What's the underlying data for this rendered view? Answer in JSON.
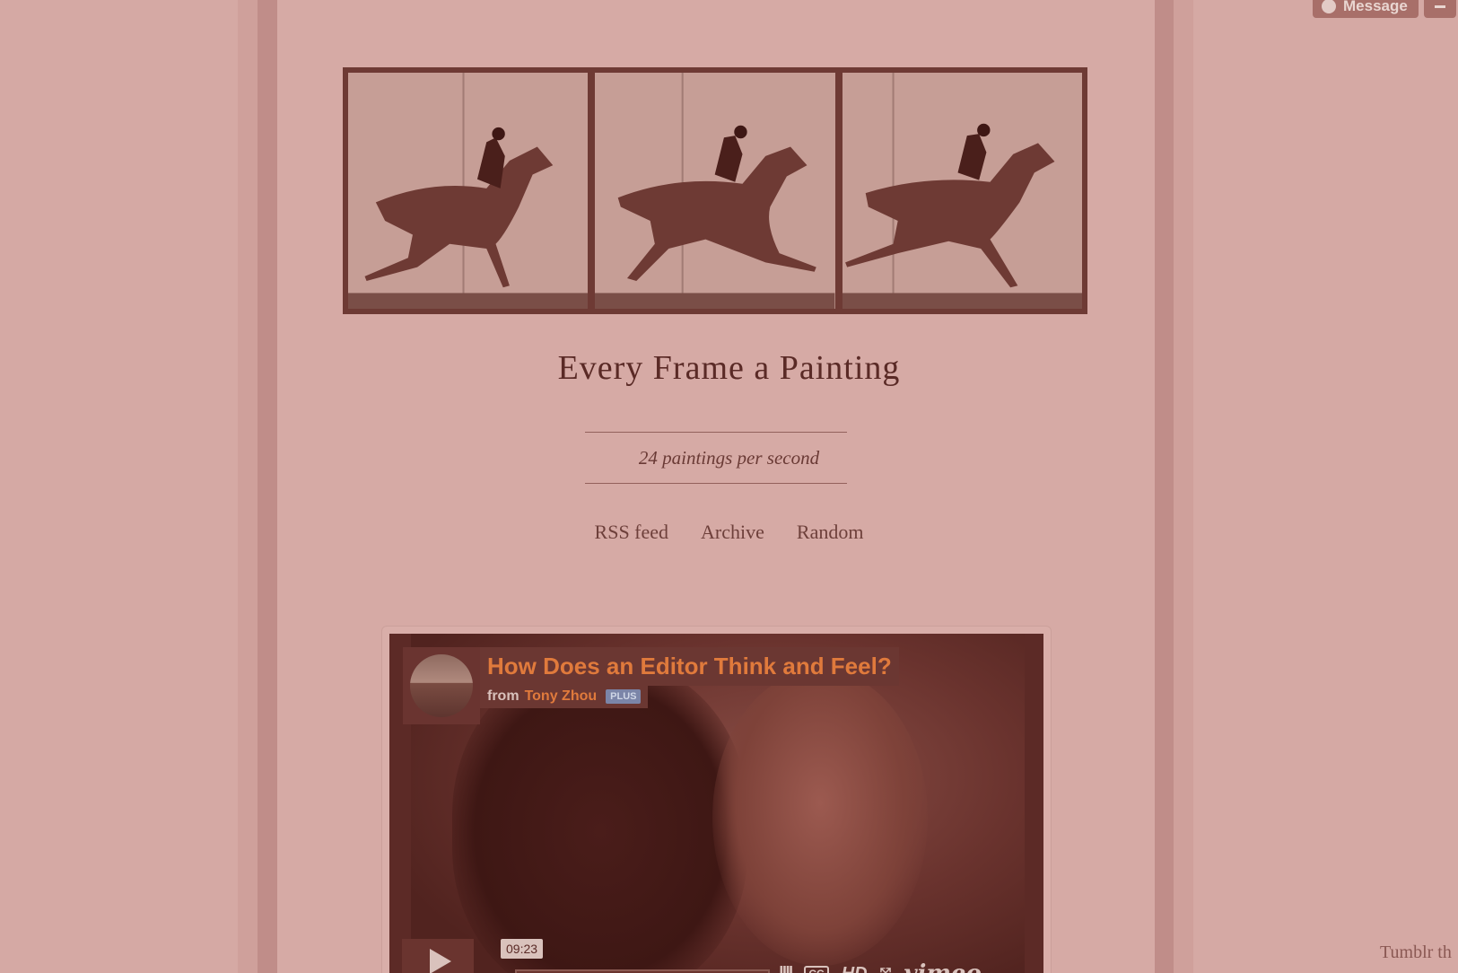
{
  "blog": {
    "title": "Every Frame a Painting",
    "tagline": "24 paintings per second"
  },
  "nav": {
    "items": [
      {
        "label": "RSS feed"
      },
      {
        "label": "Archive"
      },
      {
        "label": "Random"
      }
    ]
  },
  "video": {
    "title": "How Does an Editor Think and Feel?",
    "from_label": "from",
    "author": "Tony Zhou",
    "badge": "PLUS",
    "duration": "09:23",
    "brand": "vimeo",
    "hd_label": "HD",
    "cc_label": "CC"
  },
  "tumblr_controls": {
    "message_label": "Message"
  },
  "footer": {
    "tumblr_text": "Tumblr th"
  },
  "colors": {
    "background": "#d5a9a4",
    "title": "#5a2a26",
    "video_title": "#e07a3c"
  }
}
